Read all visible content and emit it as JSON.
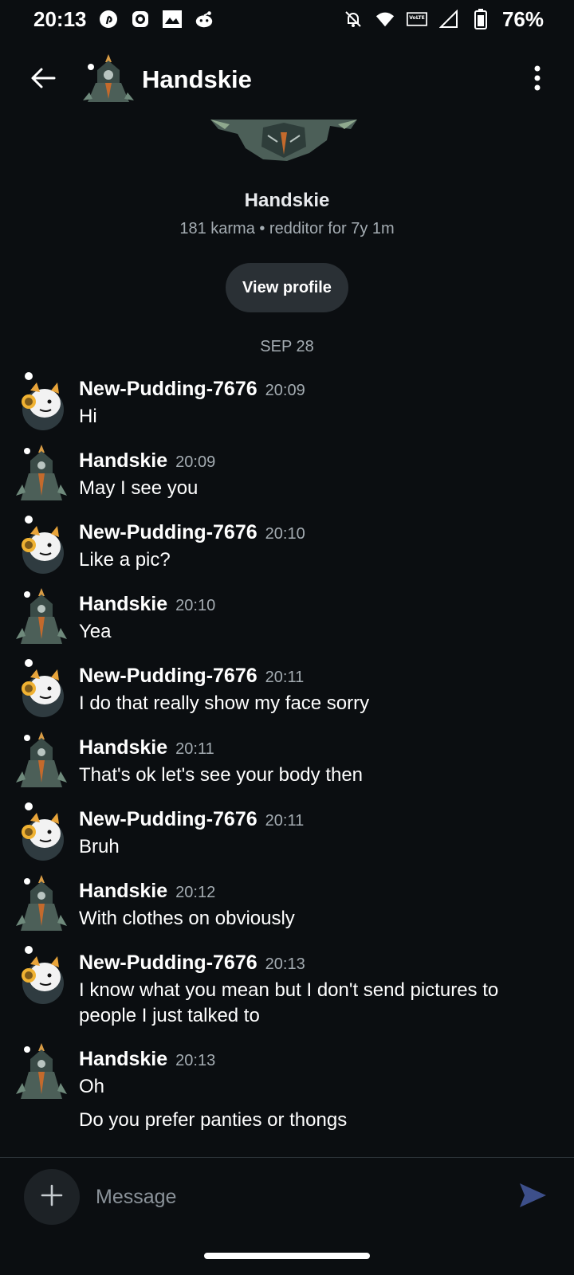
{
  "status_bar": {
    "time": "20:13",
    "battery": "76%",
    "left_icons": [
      "pinterest-icon",
      "app-icon",
      "gallery-icon",
      "reddit-icon"
    ],
    "right_icons": [
      "notifications-off-icon",
      "wifi-icon",
      "volte-icon",
      "signal-icon",
      "battery-icon"
    ]
  },
  "header": {
    "title": "Handskie",
    "back_icon": "arrow-left-icon",
    "menu_icon": "more-vertical-icon"
  },
  "profile": {
    "name": "Handskie",
    "meta": "181 karma • redditor for 7y 1m",
    "view_profile_label": "View profile"
  },
  "date_divider": "SEP 28",
  "messages": [
    {
      "author": "New-Pudding-7676",
      "time": "20:09",
      "lines": [
        "Hi"
      ]
    },
    {
      "author": "Handskie",
      "time": "20:09",
      "lines": [
        "May I see you"
      ]
    },
    {
      "author": "New-Pudding-7676",
      "time": "20:10",
      "lines": [
        "Like a pic?"
      ]
    },
    {
      "author": "Handskie",
      "time": "20:10",
      "lines": [
        "Yea"
      ]
    },
    {
      "author": "New-Pudding-7676",
      "time": "20:11",
      "lines": [
        "I do that really show my face sorry"
      ]
    },
    {
      "author": "Handskie",
      "time": "20:11",
      "lines": [
        "That's ok let's see your body then"
      ]
    },
    {
      "author": "New-Pudding-7676",
      "time": "20:11",
      "lines": [
        "Bruh"
      ]
    },
    {
      "author": "Handskie",
      "time": "20:12",
      "lines": [
        "With clothes on obviously"
      ]
    },
    {
      "author": "New-Pudding-7676",
      "time": "20:13",
      "lines": [
        "I know what you mean but I don't send pictures to people I just talked to"
      ]
    },
    {
      "author": "Handskie",
      "time": "20:13",
      "lines": [
        "Oh",
        "Do you prefer panties or thongs"
      ]
    }
  ],
  "composer": {
    "placeholder": "Message",
    "add_icon": "plus-icon",
    "send_icon": "send-icon"
  },
  "colors": {
    "background": "#0b0e11",
    "button": "#2a3035",
    "muted_text": "#a4acb2",
    "send_accent": "#3d4f8a"
  }
}
